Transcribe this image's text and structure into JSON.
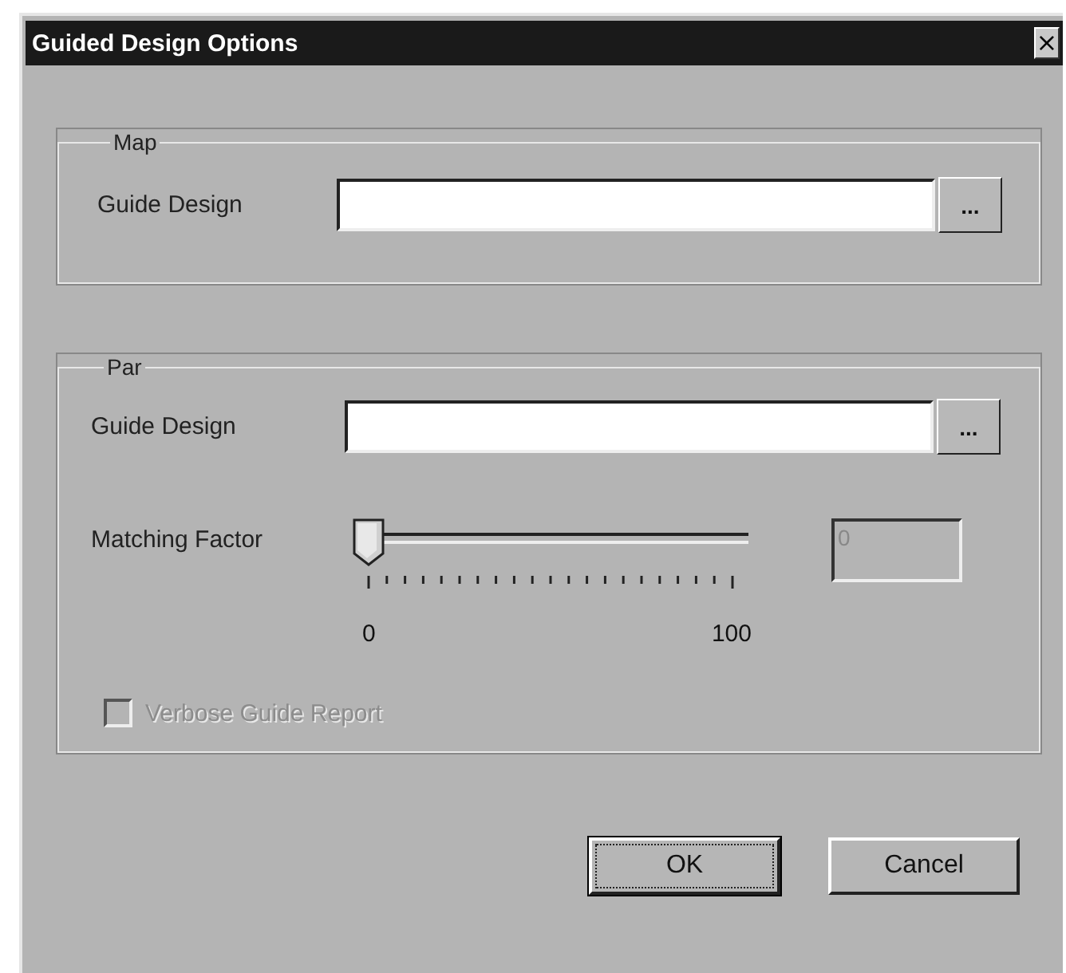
{
  "window": {
    "title": "Guided Design Options",
    "close": "×"
  },
  "map": {
    "title": "Map",
    "label": "Guide Design",
    "browse": "..."
  },
  "par": {
    "title": "Par",
    "label": "Guide Design",
    "browse": "...",
    "slider": {
      "label": "Matching Factor",
      "level": 0,
      "min_label": "0",
      "max_label": "100",
      "value": "0",
      "disabled": true
    },
    "checkbox": {
      "label": "Verbose Guide Report",
      "checked": false,
      "disabled": true
    }
  },
  "buttons": [
    {
      "label": "OK",
      "default": true
    },
    {
      "label": "Cancel",
      "default": false
    }
  ]
}
